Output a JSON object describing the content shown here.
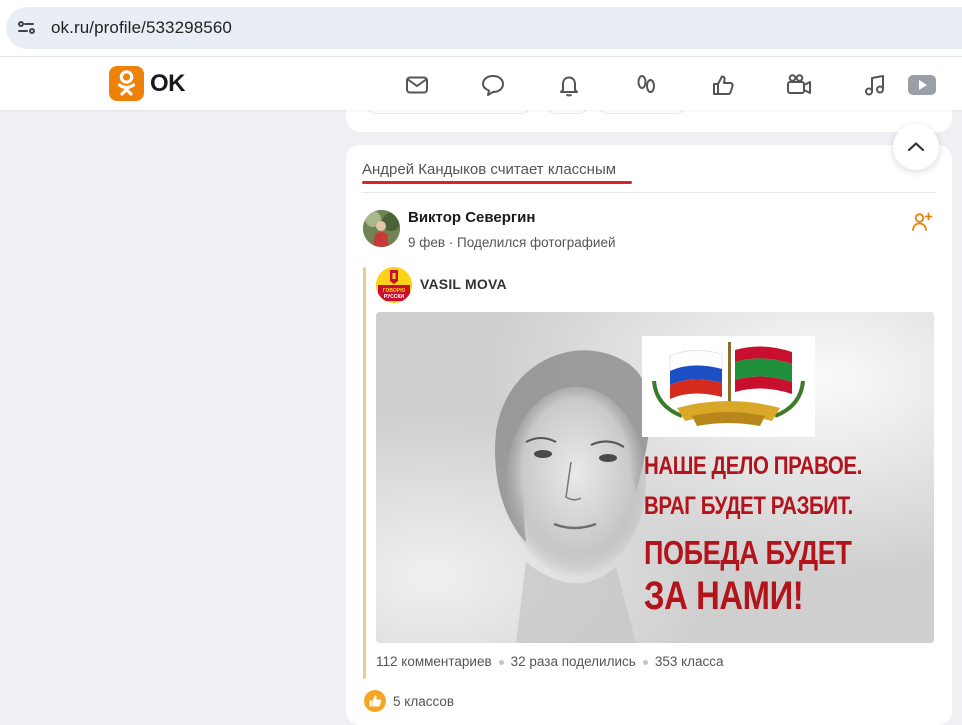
{
  "browser": {
    "url": "ok.ru/profile/533298560"
  },
  "header": {
    "logo_text": "OK",
    "nav_icons": [
      "mail-icon",
      "chat-icon",
      "bell-icon",
      "guests-icon",
      "like-icon",
      "video-icon",
      "music-icon",
      "play-icon"
    ]
  },
  "post": {
    "heading": "Андрей Кандыков считает классным",
    "author_name": "Виктор Севергин",
    "date": "9 фев",
    "action": "Поделился фотографией",
    "meta": "9 фев · Поделился фотографией",
    "group_name": "VASIL MOVA",
    "group_avatar_text": "ГОВОРЮ РУССКИ",
    "image_slogans": [
      "НАШЕ ДЕЛО ПРАВОЕ.",
      "ВРАГ БУДЕТ РАЗБИТ.",
      "ПОБЕДА БУДЕТ",
      "ЗА НАМИ!"
    ],
    "comments": "112 комментариев",
    "shares": "32 раза поделились",
    "classes": "353 класса",
    "likes": "5 классов"
  },
  "colors": {
    "ok_orange": "#ee8208",
    "underline_red": "#d8222a",
    "repost_line": "#f3c98a"
  }
}
